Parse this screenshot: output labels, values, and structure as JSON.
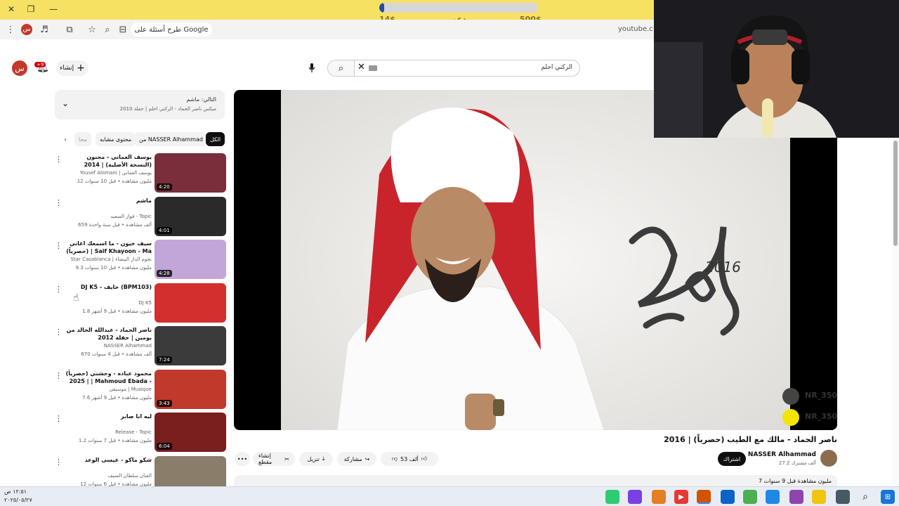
{
  "browser": {
    "window_controls": {
      "close": "✕",
      "restore": "❐",
      "minimize": "—"
    },
    "donation": {
      "left_label": "14$",
      "middle_label": "دعم",
      "right_label": "500$",
      "progress": 0.03
    },
    "address": {
      "search_suggestion": "طرح أسئلة على Google",
      "url": "youtube.c",
      "profile_letter": "س"
    }
  },
  "header": {
    "create_label": "إنشاء",
    "notification_count": "+9",
    "search_query": "الركني احلم",
    "avatar_letter": "س"
  },
  "playlist": {
    "next_label": "التالي: ماشم",
    "subtitle": "ميكس ناصر الحماد - الركني احلم | حفلة 2010"
  },
  "chips": [
    "الكل",
    "من NASSER Alhammad",
    "محتوى مشابه",
    "محا"
  ],
  "related": [
    {
      "title": "يوسف العماني - مجنون (النسخة الأصلية) | 2014",
      "channel": "Yousef Alomani | يوسف العماني",
      "meta": "12 مليون مشاهدة • قبل 10 سنوات",
      "duration": "4:20"
    },
    {
      "title": "ماشم",
      "channel": "فواز السعيد - Topic",
      "meta": "659 ألف مشاهدة • قبل سنة واحدة",
      "duration": "4:01"
    },
    {
      "title": "سيف خيون - ما اسمعك اغاني (حصرياً) | Saif Khayoon - Ma Asamaek ...",
      "channel": "Star Casablanca | نجوم الدار البيضاء",
      "meta": "9.3 مليون مشاهدة • قبل 10 سنوات",
      "duration": "4:28"
    },
    {
      "title": "DJ K5 - خايف (BPM103)",
      "channel": "DJ K5",
      "meta": "1.8 مليون مشاهدة • قبل 9 أشهر",
      "duration": ""
    },
    {
      "title": "ناصر الحماد - عبدالله الخالد من يومين | حفلة 2012",
      "channel": "NASSER Alhammad",
      "meta": "670 ألف مشاهدة • قبل 4 سنوات",
      "duration": "7:24"
    },
    {
      "title": "محمود عباده - وحشني (حصرياً) | 2025 | Mahmoud Ebada - Wahashny",
      "channel": "موسيقى | Musique",
      "meta": "7.6 مليون مشاهدة • قبل 9 أشهر",
      "duration": "3:43"
    },
    {
      "title": "ليه انا صابر",
      "channel": "Release - Topic",
      "meta": "1.2 مليون مشاهدة • قبل 7 سنوات",
      "duration": "6:04"
    },
    {
      "title": "شكو ماكو - عيسى الوعد",
      "channel": "الفنان سلطان السيف",
      "meta": "12 مليون مشاهدة • قبل 6 سنوات",
      "duration": ""
    }
  ],
  "player": {
    "art_year": "2016",
    "instagram_handle": "NR_350",
    "snapchat_handle": "NR_350"
  },
  "video": {
    "title": "ناصر الحماد - مالك مع الطيب (حصرياً) | 2016",
    "channel_name": "NASSER Alhammad",
    "subscribers": "27.2 ألف مشترك",
    "subscribe_label": "اشتراك",
    "like_count": "53 ألف",
    "share_label": "مشاركة",
    "download_label": "تنزيل",
    "clip_label": "إنشاء مقطع",
    "more_label": "•••",
    "views_meta": "7 مليون مشاهدة  قبل 9 سنوات"
  },
  "taskbar": {
    "time": "١٢:٥١ ص",
    "date": "٢٠٢٥/٠٥/٢٧"
  }
}
